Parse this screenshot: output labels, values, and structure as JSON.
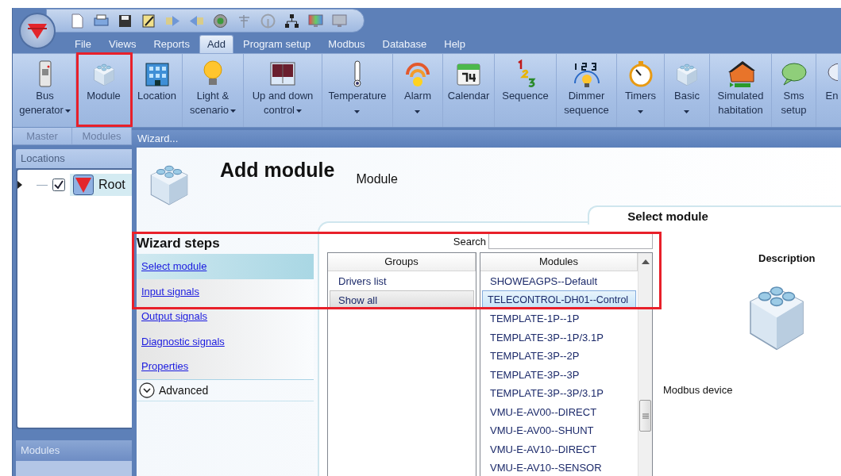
{
  "menu_tabs": [
    {
      "label": "File",
      "selected": false
    },
    {
      "label": "Views",
      "selected": false
    },
    {
      "label": "Reports",
      "selected": false
    },
    {
      "label": "Add",
      "selected": true
    },
    {
      "label": "Program setup",
      "selected": false
    },
    {
      "label": "Modbus",
      "selected": false
    },
    {
      "label": "Database",
      "selected": false
    },
    {
      "label": "Help",
      "selected": false
    }
  ],
  "ribbon": {
    "buttons": [
      {
        "lines": [
          "Bus",
          "generator"
        ],
        "dropdown": true
      },
      {
        "lines": [
          "Module"
        ],
        "dropdown": false
      },
      {
        "lines": [
          "Location"
        ],
        "dropdown": false
      },
      {
        "lines": [
          "Light &",
          "scenario"
        ],
        "dropdown": true
      },
      {
        "lines": [
          "Up and down",
          "control"
        ],
        "dropdown": true
      },
      {
        "lines": [
          "Temperature"
        ],
        "dropdown": true
      },
      {
        "lines": [
          "Alarm"
        ],
        "dropdown": true
      },
      {
        "lines": [
          "Calendar"
        ],
        "dropdown": false
      },
      {
        "lines": [
          "Sequence"
        ],
        "dropdown": false
      },
      {
        "lines": [
          "Dimmer",
          "sequence"
        ],
        "dropdown": false
      },
      {
        "lines": [
          "Timers"
        ],
        "dropdown": true
      },
      {
        "lines": [
          "Basic"
        ],
        "dropdown": true
      },
      {
        "lines": [
          "Simulated",
          "habitation"
        ],
        "dropdown": false
      },
      {
        "lines": [
          "Sms",
          "setup"
        ],
        "dropdown": false
      },
      {
        "lines": [
          "En"
        ],
        "dropdown": false
      }
    ],
    "group_labels": [
      "Master",
      "Modules"
    ]
  },
  "sidebar": {
    "locations_title": "Locations",
    "tree": [
      {
        "label": "Root",
        "checked": true,
        "selected": true
      }
    ],
    "modules_title": "Modules"
  },
  "wizard": {
    "title": "Wizard...",
    "heading": "Add module",
    "subheading": "Module",
    "page_title": "Select module",
    "steps_title": "Wizard steps",
    "steps": [
      {
        "label": "Select module",
        "selected": true
      },
      {
        "label": "Input signals",
        "selected": false
      },
      {
        "label": "Output signals",
        "selected": false
      },
      {
        "label": "Diagnostic signals",
        "selected": false
      },
      {
        "label": "Properties",
        "selected": false
      }
    ],
    "advanced": {
      "label": "Advanced",
      "expanded": false
    },
    "search": {
      "label": "Search"
    },
    "groups": {
      "header": "Groups",
      "items": [
        {
          "label": "Drivers list",
          "selected": false
        },
        {
          "label": "Show all",
          "selected": true
        }
      ]
    },
    "modules": {
      "header": "Modules",
      "items": [
        {
          "label": "SHOWEAGPS--Default",
          "selected": false
        },
        {
          "label": "TELECONTROL-DH01--Control",
          "selected": true
        },
        {
          "label": "TEMPLATE-1P--1P",
          "selected": false
        },
        {
          "label": "TEMPLATE-3P--1P/3.1P",
          "selected": false
        },
        {
          "label": "TEMPLATE-3P--2P",
          "selected": false
        },
        {
          "label": "TEMPLATE-3P--3P",
          "selected": false
        },
        {
          "label": "TEMPLATE-3P--3P/3.1P",
          "selected": false
        },
        {
          "label": "VMU-E-AV00--DIRECT",
          "selected": false
        },
        {
          "label": "VMU-E-AV00--SHUNT",
          "selected": false
        },
        {
          "label": "VMU-E-AV10--DIRECT",
          "selected": false
        },
        {
          "label": "VMU-E-AV10--SENSOR",
          "selected": false
        }
      ]
    },
    "description": {
      "title": "Description",
      "text": "Modbus device"
    }
  }
}
